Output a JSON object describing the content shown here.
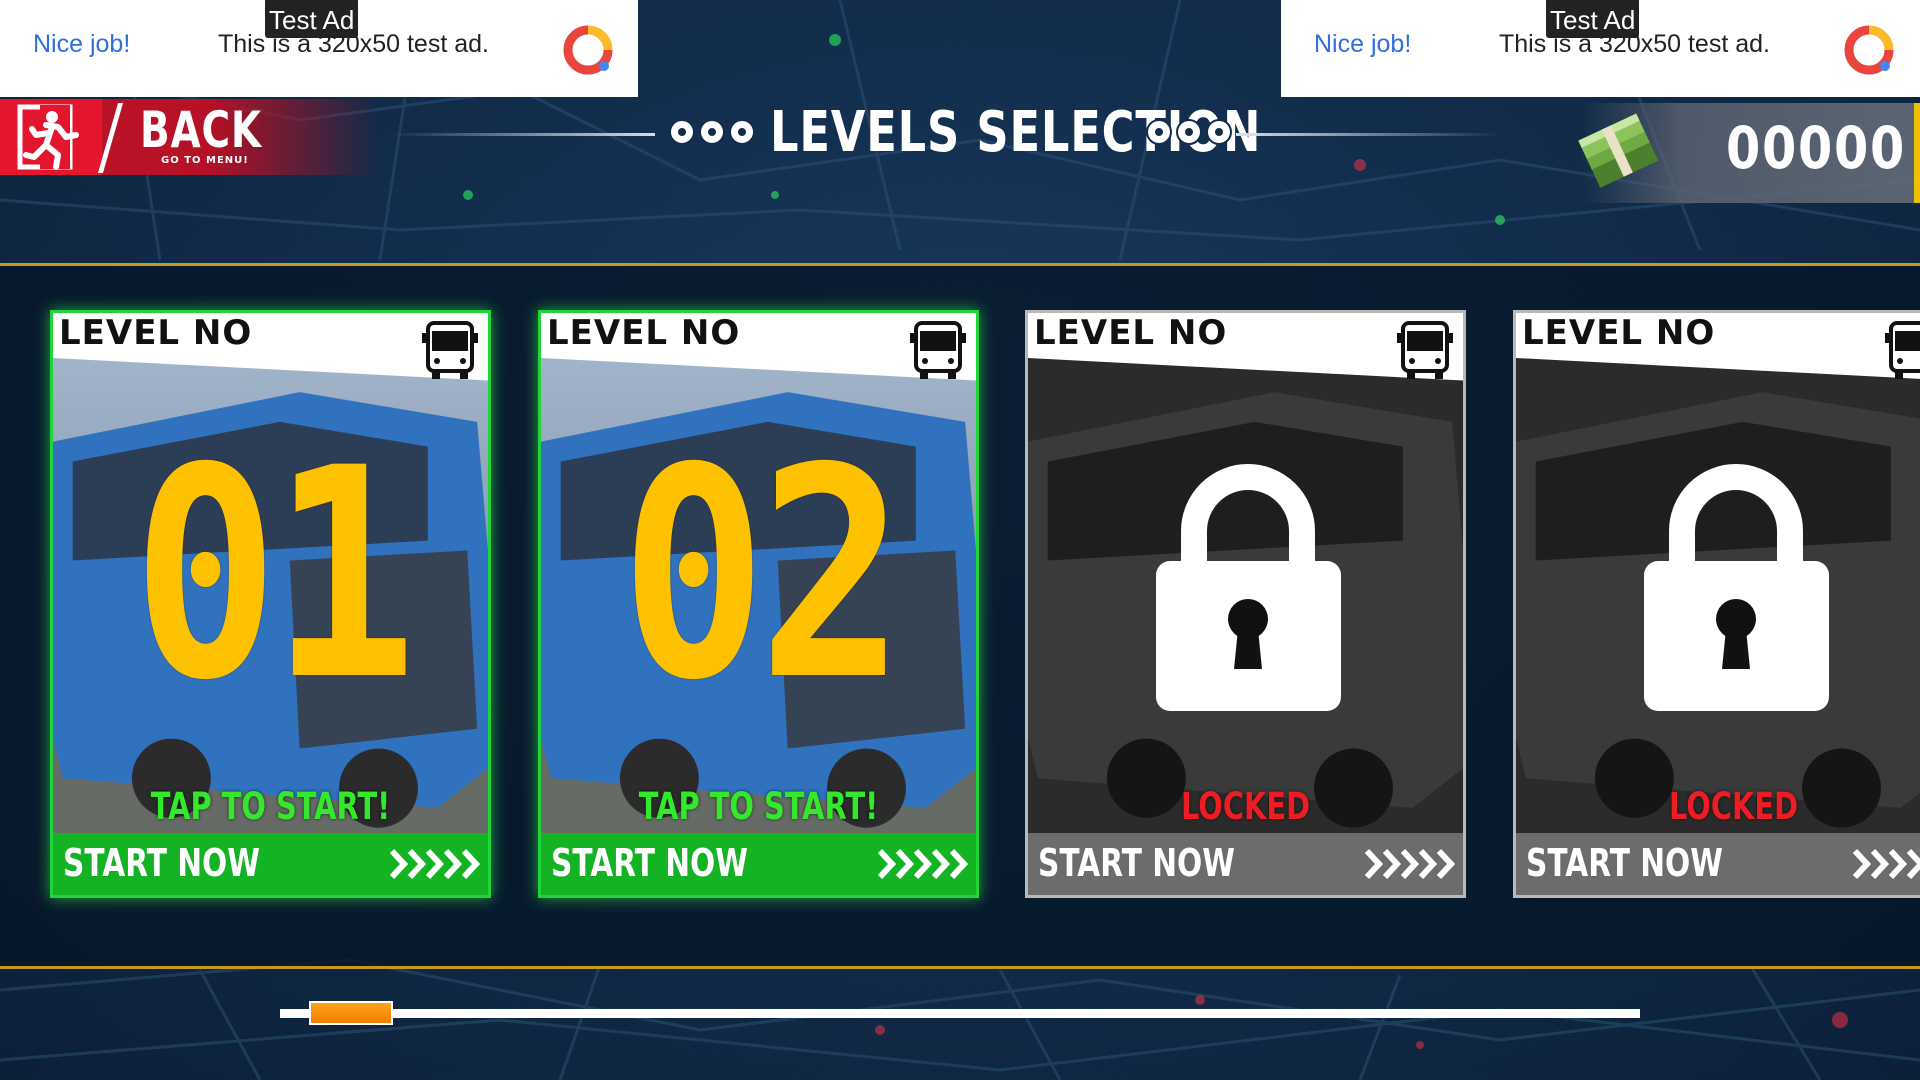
{
  "ads": [
    {
      "tag": "Test Ad",
      "headline": "Nice job!",
      "text": "This is a 320x50 test ad."
    },
    {
      "tag": "Test Ad",
      "headline": "Nice job!",
      "text": "This is a 320x50 test ad."
    }
  ],
  "header": {
    "back_label": "BACK",
    "back_sub": "GO TO MENU!",
    "title": "LEVELS SELECTION",
    "cash": "00000"
  },
  "levels": [
    {
      "label": "LEVEL NO",
      "number": "01",
      "status": "TAP TO START!",
      "locked": false,
      "button": "START NOW"
    },
    {
      "label": "LEVEL NO",
      "number": "02",
      "status": "TAP TO START!",
      "locked": false,
      "button": "START NOW"
    },
    {
      "label": "LEVEL NO",
      "number": "",
      "status": "LOCKED",
      "locked": true,
      "button": "START NOW"
    },
    {
      "label": "LEVEL NO",
      "number": "",
      "status": "LOCKED",
      "locked": true,
      "button": "START NOW"
    }
  ],
  "scroll": {
    "position": 0.03
  },
  "colors": {
    "accent_gold": "#c99a1a",
    "unlocked_green": "#21d43a",
    "locked_red": "#ee1c23",
    "number_yellow": "#fdc100",
    "back_red": "#e3162d"
  }
}
